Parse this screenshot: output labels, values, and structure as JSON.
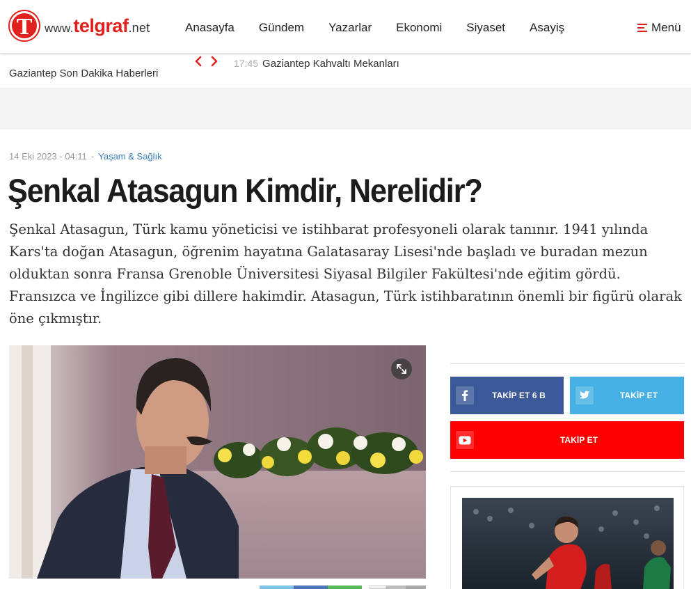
{
  "site": {
    "logo_letter": "T",
    "logo_prefix": "www.",
    "logo_brand": "telgraf",
    "logo_tld": ".net",
    "brand_color": "#e1211e"
  },
  "nav": {
    "items": [
      {
        "label": "Anasayfa"
      },
      {
        "label": "Gündem"
      },
      {
        "label": "Yazarlar"
      },
      {
        "label": "Ekonomi"
      },
      {
        "label": "Siyaset"
      },
      {
        "label": "Asayiş"
      }
    ],
    "menu_label": "Menü",
    "menu_icon": "hamburger-icon"
  },
  "ticker": {
    "title": "Gaziantep Son Dakika Haberleri",
    "prev_icon": "chevron-left-icon",
    "next_icon": "chevron-right-icon",
    "item_time": "17:45",
    "item_text": "Gaziantep Kahvaltı Mekanları"
  },
  "article": {
    "date": "14 Eki 2023 - 04:11",
    "separator": "-",
    "category": "Yaşam & Sağlık",
    "title": "Şenkal Atasagun Kimdir, Nerelidir?",
    "lead": "Şenkal Atasagun, Türk kamu yöneticisi ve istihbarat profesyoneli olarak tanınır. 1941 yılında Kars'ta doğan Atasagun, öğrenim hayatına Galatasaray Lisesi'nde başladı ve buradan mezun olduktan sonra Fransa Grenoble Üniversitesi Siyasal Bilgiler Fakültesi'nde eğitim gördü. Fransızca ve İngilizce gibi dillere hakimdir. Atasagun, Türk istihbaratının önemli bir figürü olarak öne çıkmıştır.",
    "expand_icon": "expand-icon"
  },
  "social": {
    "facebook": {
      "label": "TAKİP ET 6 B",
      "icon": "facebook-icon",
      "color": "#3b5998"
    },
    "twitter": {
      "label": "TAKİP ET",
      "icon": "twitter-icon",
      "color": "#45b0e3"
    },
    "youtube": {
      "label": "TAKİP ET",
      "icon": "youtube-icon",
      "color": "#ff0000"
    }
  }
}
